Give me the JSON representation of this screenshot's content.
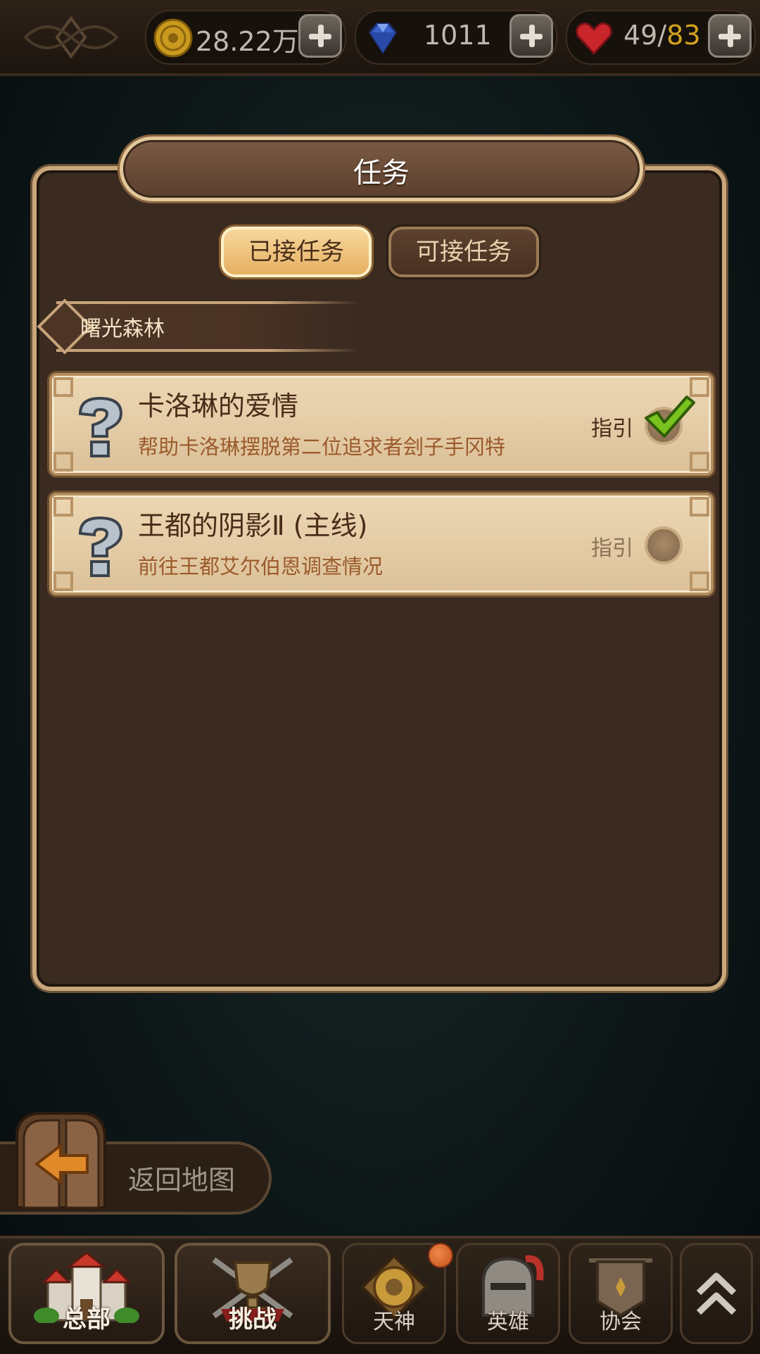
{
  "resources": {
    "gold": {
      "value": "28.22万",
      "icon": "gold-coin-icon"
    },
    "diamond": {
      "value": "1011",
      "icon": "diamond-icon"
    },
    "stamina": {
      "current": "49",
      "separator": "/",
      "max": "83",
      "icon": "heart-icon"
    }
  },
  "dialog": {
    "title": "任务",
    "tabs": [
      {
        "label": "已接任务",
        "active": true
      },
      {
        "label": "可接任务",
        "active": false
      }
    ],
    "region": "曙光森林",
    "quests": [
      {
        "title": "卡洛琳的爱情",
        "description": "帮助卡洛琳摆脱第二位追求者刽子手冈特",
        "guide_label": "指引",
        "guide_selected": true
      },
      {
        "title": "王都的阴影Ⅱ (主线)",
        "description": "前往王都艾尔伯恩调查情况",
        "guide_label": "指引",
        "guide_selected": false
      }
    ]
  },
  "return_button": {
    "label": "返回地图"
  },
  "bottom_nav": [
    {
      "label": "总部",
      "icon": "castle-icon"
    },
    {
      "label": "挑战",
      "icon": "trophy-icon"
    },
    {
      "label": "天神",
      "icon": "god-emblem-icon",
      "has_badge": true
    },
    {
      "label": "英雄",
      "icon": "helmet-icon"
    },
    {
      "label": "协会",
      "icon": "banner-icon"
    },
    {
      "label": "",
      "icon": "double-chevron-up-icon"
    }
  ],
  "colors": {
    "accent_gold": "#d4a31f",
    "panel_bg": "#3a2a20",
    "card_bg": "#e3caa3",
    "active_tab": "#f0c57f"
  }
}
